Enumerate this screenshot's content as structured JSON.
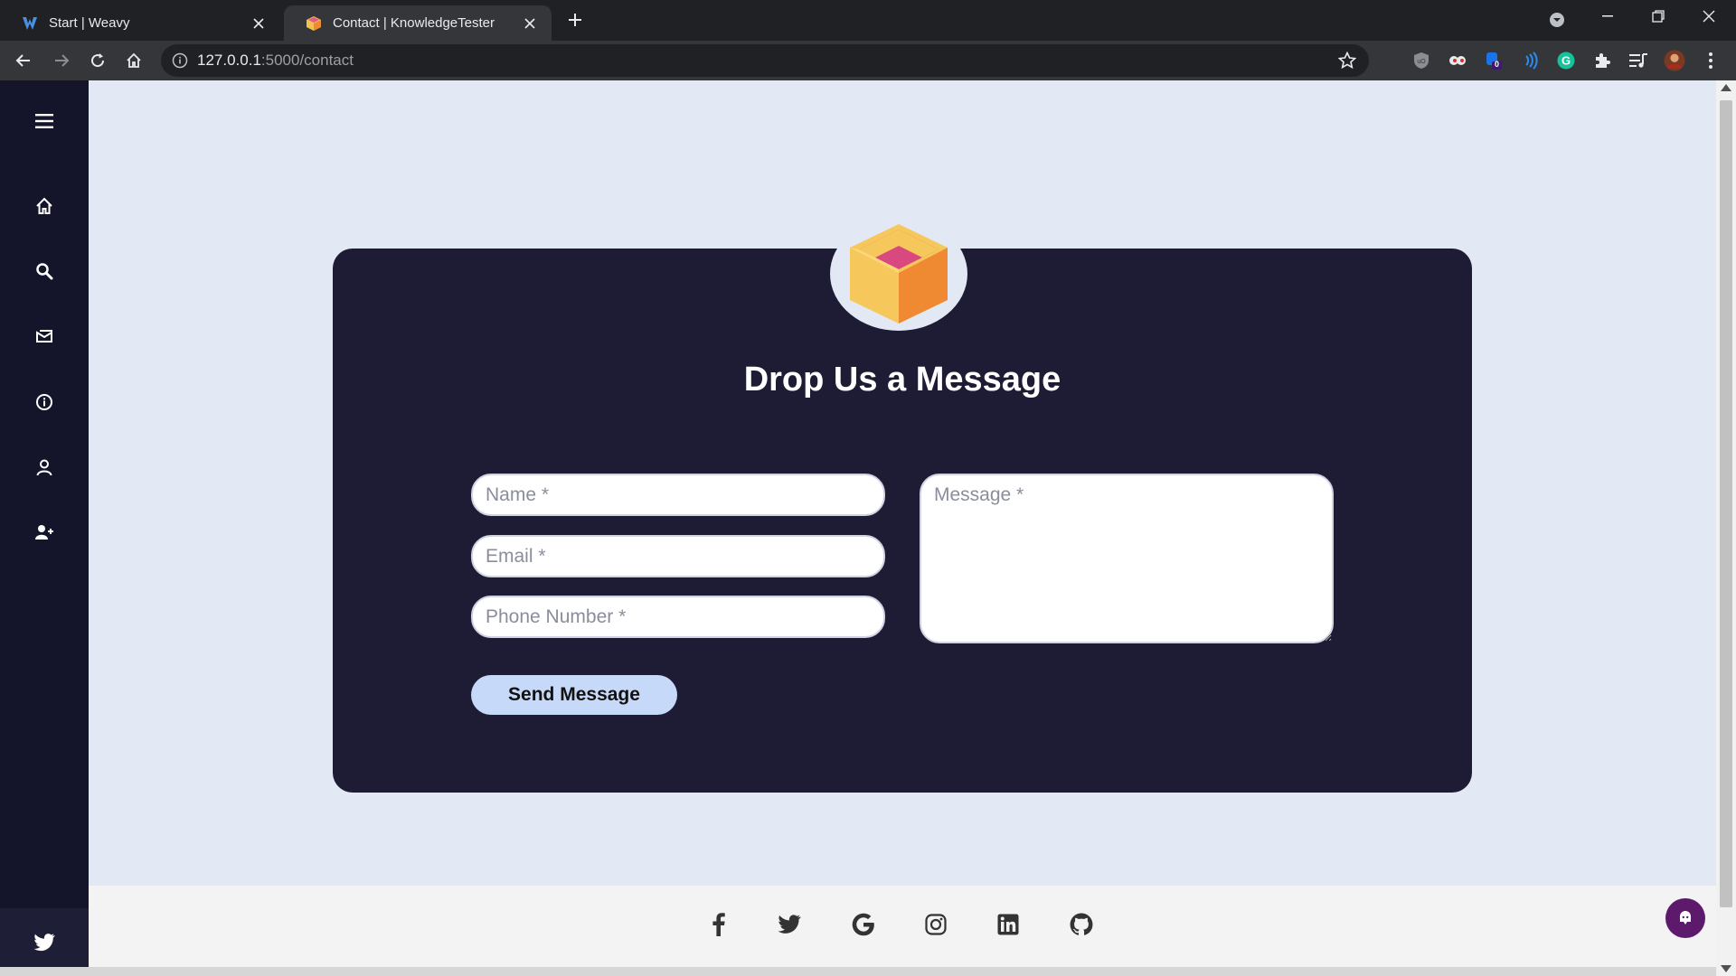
{
  "browser": {
    "tabs": [
      {
        "title": "Start | Weavy",
        "active": false,
        "icon": "weavy-logo-icon"
      },
      {
        "title": "Contact | KnowledgeTester",
        "active": true,
        "icon": "box-logo-icon"
      }
    ],
    "address": {
      "host": "127.0.0.1",
      "path": ":5000/contact"
    }
  },
  "sidebar": {
    "items": [
      {
        "name": "menu-icon"
      },
      {
        "name": "home-icon"
      },
      {
        "name": "search-icon"
      },
      {
        "name": "mail-icon"
      },
      {
        "name": "info-icon"
      },
      {
        "name": "user-icon"
      },
      {
        "name": "user-plus-icon"
      }
    ],
    "bottom_icon": "twitter-icon"
  },
  "contact": {
    "heading": "Drop Us a Message",
    "name_placeholder": "Name *",
    "email_placeholder": "Email *",
    "phone_placeholder": "Phone Number *",
    "message_placeholder": "Message *",
    "send_label": "Send Message"
  },
  "footer": {
    "social": [
      "facebook-icon",
      "twitter-icon",
      "google-icon",
      "instagram-icon",
      "linkedin-icon",
      "github-icon"
    ]
  },
  "extensions": {
    "badge_count": "0"
  },
  "colors": {
    "sidebar": "#14142a",
    "card": "#1e1c34",
    "page_bg": "#e3e8f5",
    "send_button": "#c6d9f8",
    "chat_bubble": "#5d1a6c"
  }
}
